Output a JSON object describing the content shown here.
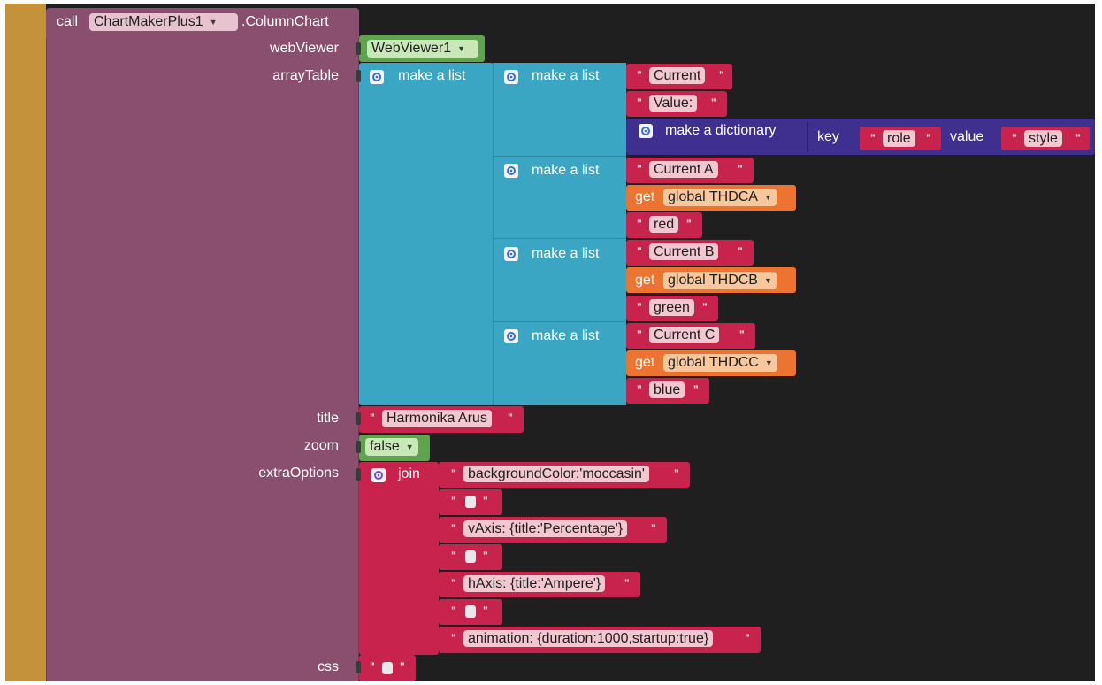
{
  "call_block": {
    "call_word": "call",
    "component": "ChartMakerPlus1",
    "method": ".ColumnChart",
    "params": {
      "webViewer": "webViewer",
      "arrayTable": "arrayTable",
      "title": "title",
      "zoom": "zoom",
      "extraOptions": "extraOptions",
      "css": "css"
    }
  },
  "webviewer_value": "WebViewer1",
  "make_list_label": "make a list",
  "make_dictionary_label": "make a dictionary",
  "key_label": "key",
  "value_label": "value",
  "get_label": "get",
  "header_row": {
    "col1": "Current",
    "col2": "Value:",
    "dict_key": "role",
    "dict_value": "style"
  },
  "rows": [
    {
      "label": "Current A",
      "variable": "global THDCA",
      "color": "red"
    },
    {
      "label": "Current B",
      "variable": "global THDCB",
      "color": "green"
    },
    {
      "label": "Current C",
      "variable": "global THDCC",
      "color": "blue"
    }
  ],
  "title_value": "Harmonika Arus",
  "zoom_value": "false",
  "join_label": "join",
  "extra_options": [
    "backgroundColor:'moccasin'",
    "",
    "vAxis: {title:'Percentage'}",
    "",
    "hAxis: {title:'Ampere'}",
    "",
    "animation: {duration:1000,startup:true}"
  ],
  "css_value": "",
  "colors": {
    "workspace": "#1f1f1f",
    "procedure": "#8a4f6f",
    "lists": "#3aa6c4",
    "text": "#c8234d",
    "logic": "#60a34f",
    "variables": "#ed7330",
    "dictionary": "#3f2f8e",
    "gutter": "#c3923a"
  }
}
